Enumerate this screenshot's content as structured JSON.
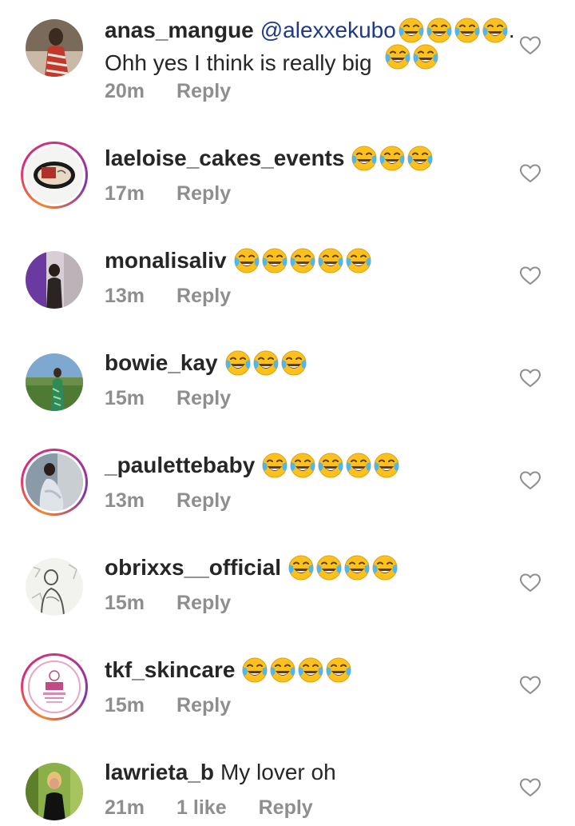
{
  "comments": [
    {
      "username": "anas_mangue",
      "mention": "@alexxekubo",
      "line1_emojis": 4,
      "line1_suffix": ".",
      "line2_text": "Ohh yes I think is really big",
      "line2_emojis": 2,
      "time": "20m",
      "likes": "",
      "reply": "Reply",
      "story_ring": false
    },
    {
      "username": "laeloise_cakes_events",
      "text": "",
      "emojis": 3,
      "time": "17m",
      "likes": "",
      "reply": "Reply",
      "story_ring": true
    },
    {
      "username": "monalisaliv",
      "text": "",
      "emojis": 5,
      "time": "13m",
      "likes": "",
      "reply": "Reply",
      "story_ring": false
    },
    {
      "username": "bowie_kay",
      "text": "",
      "emojis": 3,
      "time": "15m",
      "likes": "",
      "reply": "Reply",
      "story_ring": false
    },
    {
      "username": "_paulettebaby",
      "text": "",
      "emojis": 5,
      "time": "13m",
      "likes": "",
      "reply": "Reply",
      "story_ring": true
    },
    {
      "username": "obrixxs__official",
      "text": "",
      "emojis": 4,
      "time": "15m",
      "likes": "",
      "reply": "Reply",
      "story_ring": false
    },
    {
      "username": "tkf_skincare",
      "text": "",
      "emojis": 4,
      "time": "15m",
      "likes": "",
      "reply": "Reply",
      "story_ring": true
    },
    {
      "username": "lawrieta_b",
      "text": "My lover oh",
      "emojis": 0,
      "time": "21m",
      "likes": "1 like",
      "reply": "Reply",
      "story_ring": false
    }
  ],
  "icons": {
    "emoji": "face-with-tears-of-joy-icon",
    "like": "heart-outline-icon"
  },
  "colors": {
    "username": "#262626",
    "mention": "#1e3a8a",
    "meta": "#8e8e8e",
    "story_ring": "#dd2a7b"
  }
}
